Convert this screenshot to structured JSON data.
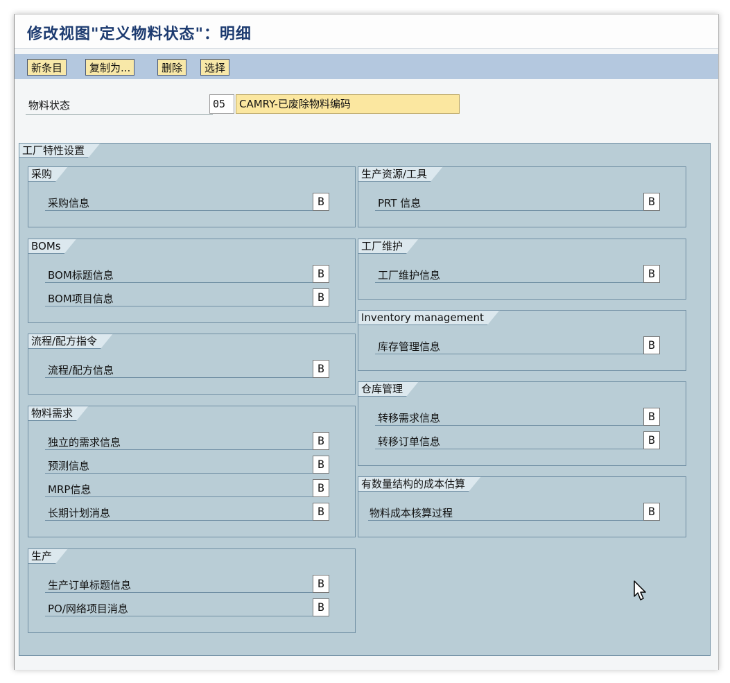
{
  "title": "修改视图\"定义物料状态\"：明细",
  "toolbar": {
    "new_entry": "新条目",
    "copy_as": "复制为...",
    "delete": "删除",
    "select": "选择"
  },
  "status_field": {
    "label": "物料状态",
    "code": "05",
    "description": "CAMRY-已废除物料编码"
  },
  "plant_section": {
    "title": "工厂特性设置"
  },
  "groups": {
    "purchasing": {
      "title": "采购",
      "rows": [
        {
          "label": "采购信息",
          "value": "B"
        }
      ]
    },
    "prt": {
      "title": "生产资源/工具",
      "rows": [
        {
          "label": "PRT 信息",
          "value": "B"
        }
      ]
    },
    "boms": {
      "title": "BOMs",
      "rows": [
        {
          "label": "BOM标题信息",
          "value": "B"
        },
        {
          "label": "BOM项目信息",
          "value": "B"
        }
      ]
    },
    "plant_maint": {
      "title": "工厂维护",
      "rows": [
        {
          "label": "工厂维护信息",
          "value": "B"
        }
      ]
    },
    "inventory": {
      "title": "Inventory management",
      "rows": [
        {
          "label": "库存管理信息",
          "value": "B"
        }
      ]
    },
    "recipe": {
      "title": "流程/配方指令",
      "rows": [
        {
          "label": "流程/配方信息",
          "value": "B"
        }
      ]
    },
    "warehouse": {
      "title": "仓库管理",
      "rows": [
        {
          "label": "转移需求信息",
          "value": "B"
        },
        {
          "label": "转移订单信息",
          "value": "B"
        }
      ]
    },
    "mrp": {
      "title": "物料需求",
      "rows": [
        {
          "label": "独立的需求信息",
          "value": "B"
        },
        {
          "label": "预测信息",
          "value": "B"
        },
        {
          "label": "MRP信息",
          "value": "B"
        },
        {
          "label": "长期计划消息",
          "value": "B"
        }
      ]
    },
    "costing": {
      "title": "有数量结构的成本估算",
      "rows": [
        {
          "label": "物料成本核算过程",
          "value": "B"
        }
      ]
    },
    "production": {
      "title": "生产",
      "rows": [
        {
          "label": "生产订单标题信息",
          "value": "B"
        },
        {
          "label": "PO/网络项目消息",
          "value": "B"
        }
      ]
    }
  },
  "colors": {
    "title": "#1d3b70",
    "toolbar_bg": "#b4c8df",
    "button_bg": "#f8e8a8",
    "frame_bg": "#b9cdd6",
    "description_bg": "#fbe7a0"
  },
  "icons": {
    "pointer": "mouse-pointer-icon"
  }
}
